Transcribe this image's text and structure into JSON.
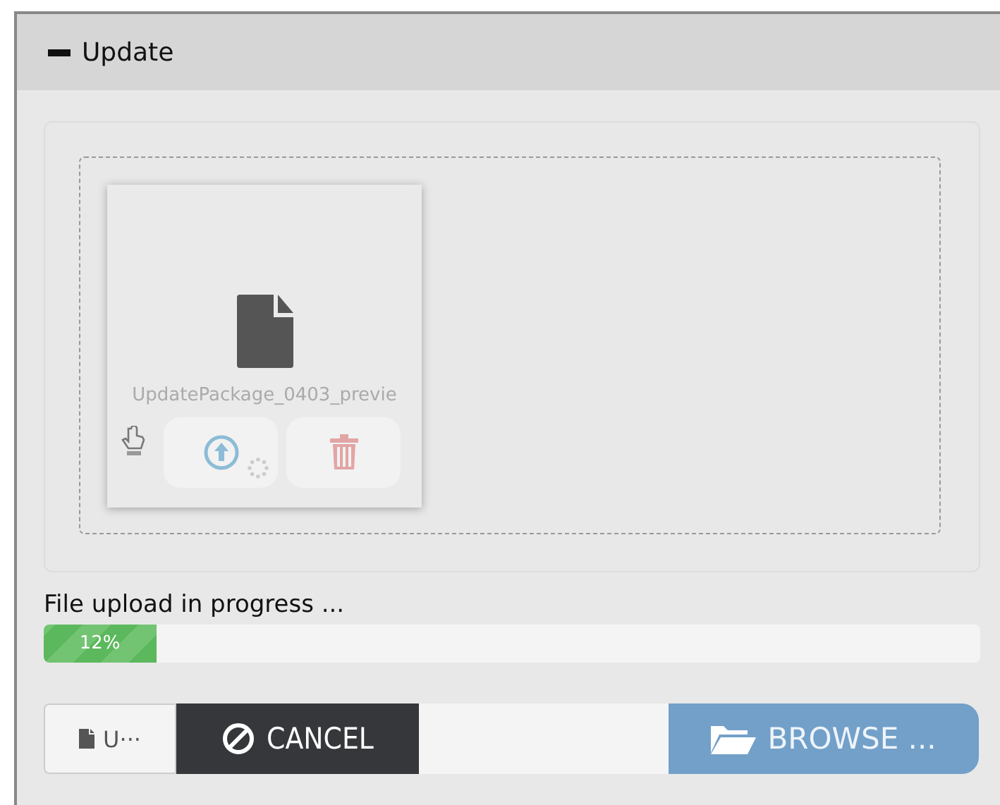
{
  "panel": {
    "title": "Update",
    "expanded": true
  },
  "files": [
    {
      "name": "UpdatePackage_0403_previe",
      "uploading": true
    }
  ],
  "status": "File upload in progress ...",
  "progress": {
    "level": 0.12,
    "label": "12%"
  },
  "caption": "U···",
  "buttons": [
    {
      "kind": "cancel",
      "label": "CANCEL"
    },
    {
      "kind": "browse",
      "label": "BROWSE ..."
    }
  ]
}
